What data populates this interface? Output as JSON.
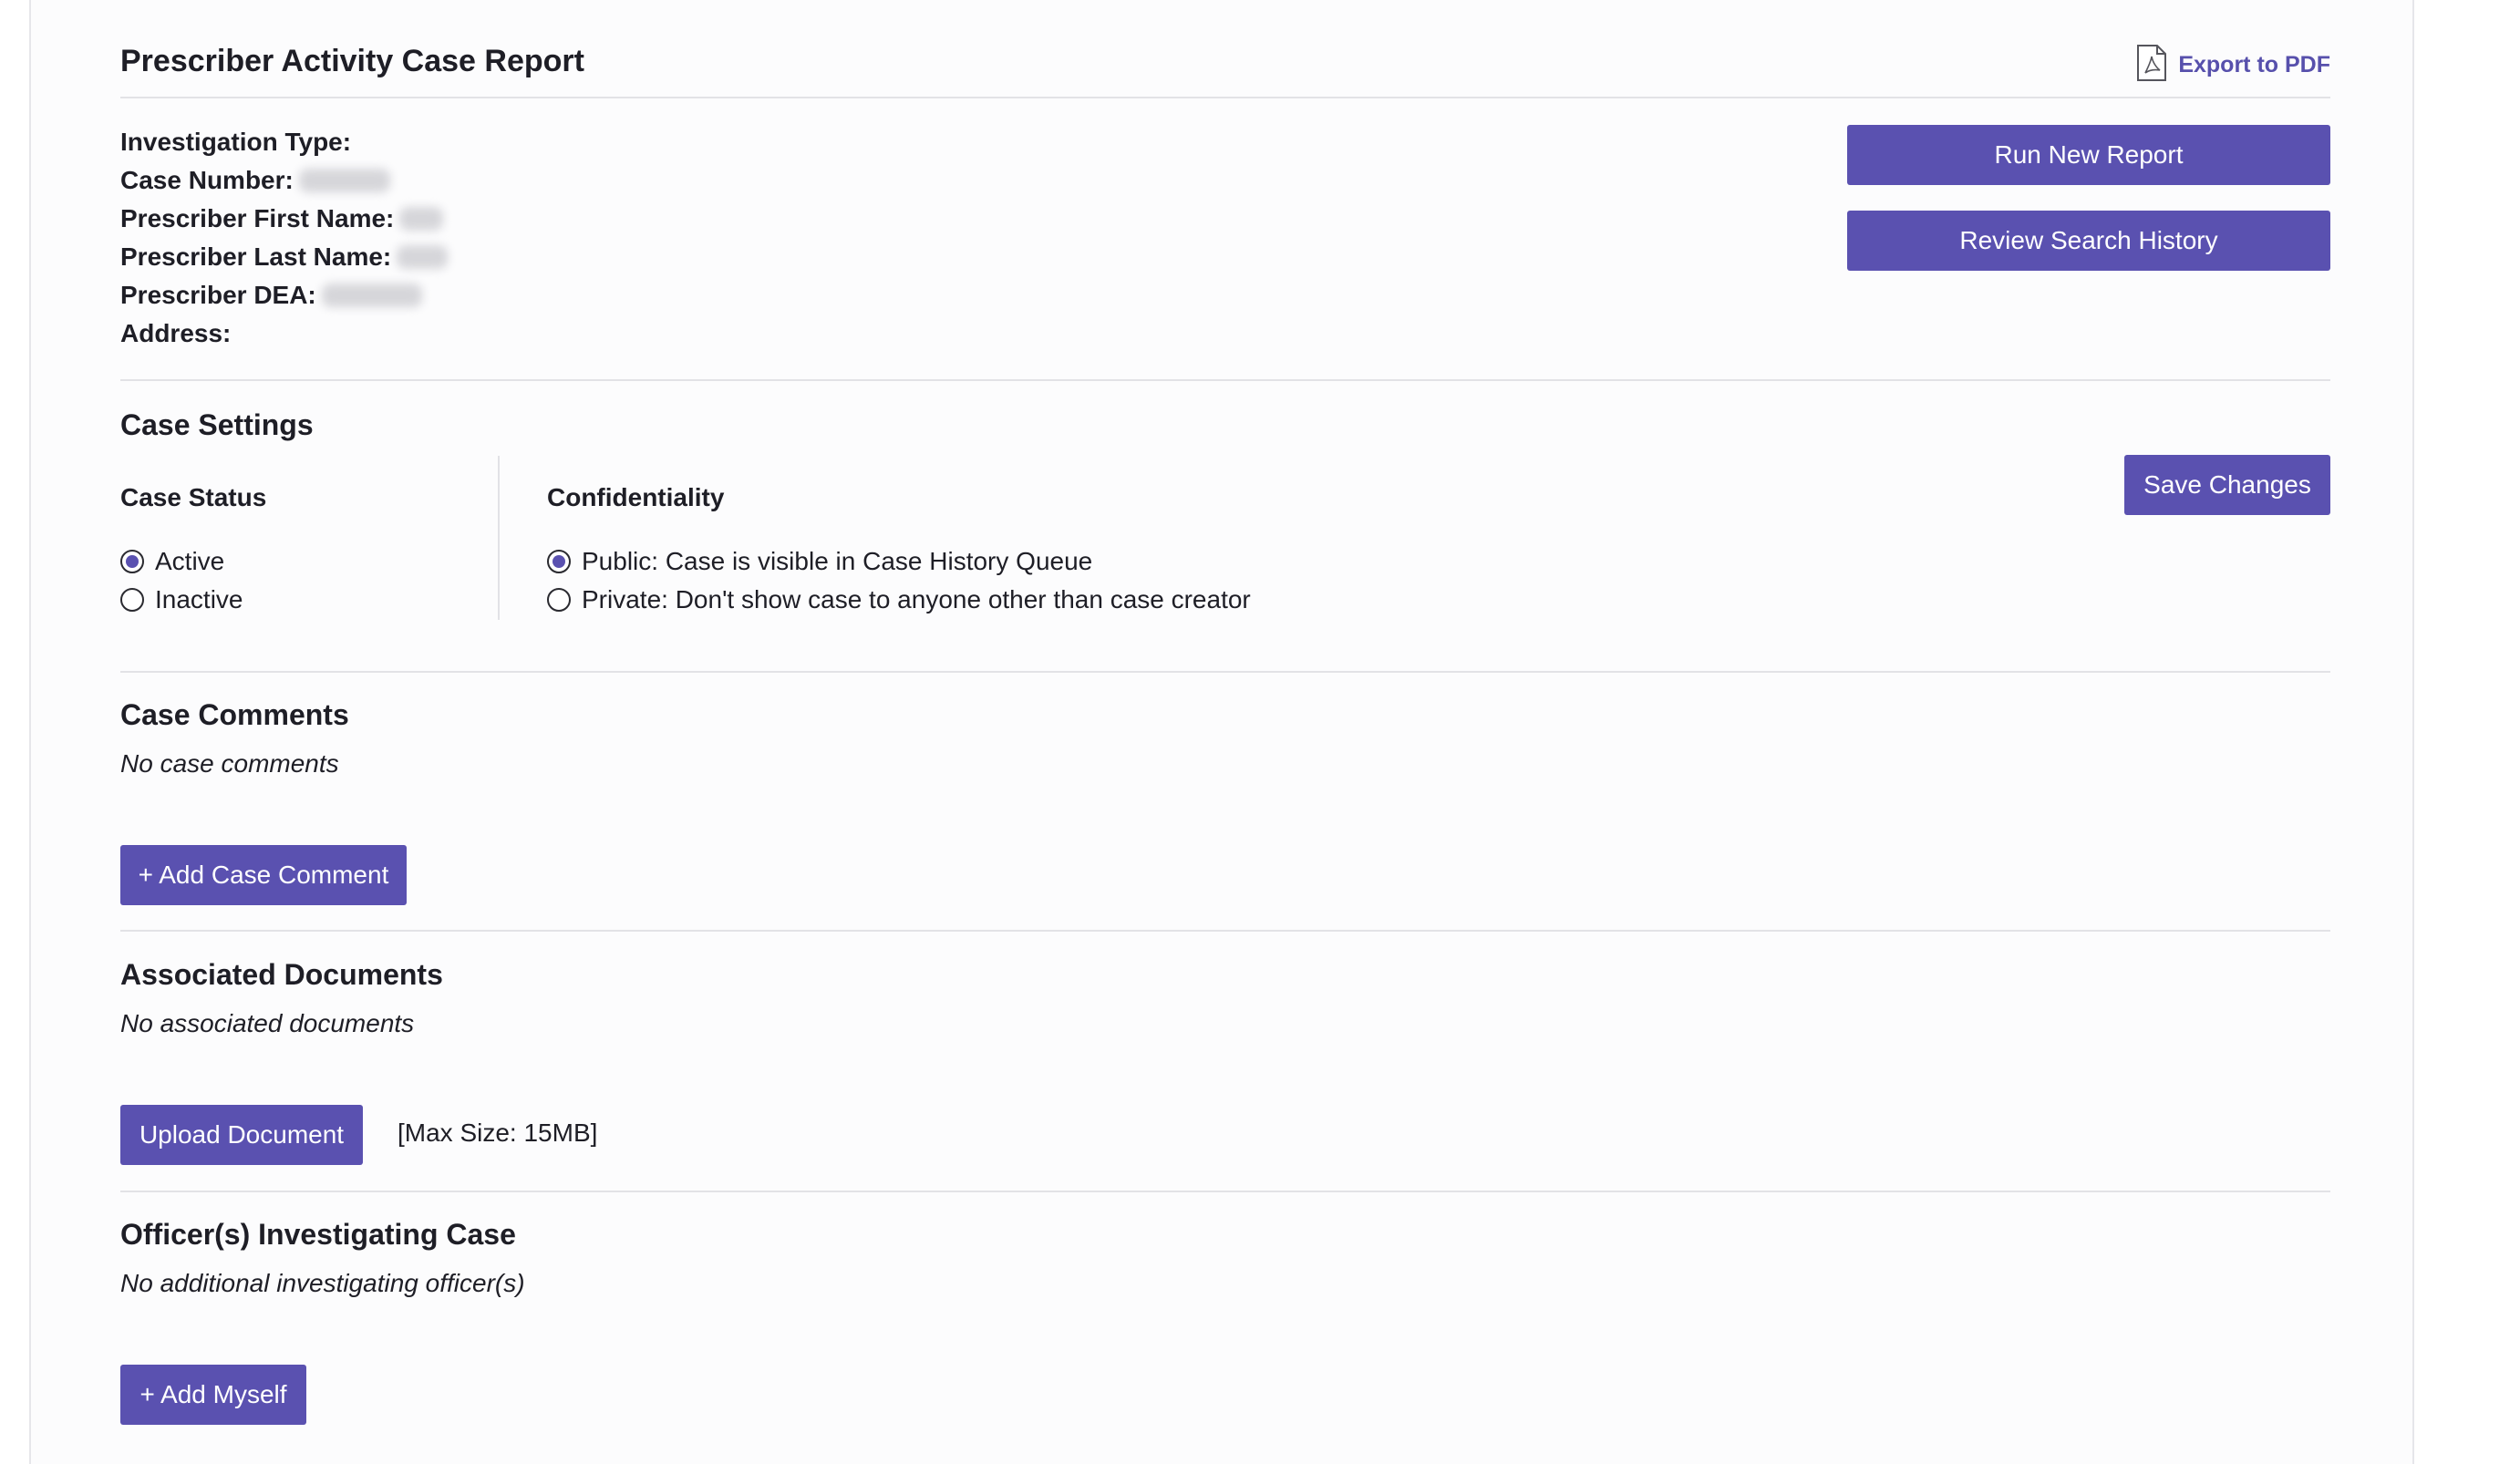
{
  "report": {
    "title": "Prescriber Activity Case Report",
    "export_label": "Export to PDF"
  },
  "details": {
    "investigation_type_label": "Investigation Type:",
    "case_number_label": "Case Number:",
    "first_name_label": "Prescriber First Name:",
    "last_name_label": "Prescriber Last Name:",
    "dea_label": "Prescriber DEA:",
    "address_label": "Address:"
  },
  "actions": {
    "run_new_report": "Run New Report",
    "review_search_history": "Review Search History"
  },
  "case_settings": {
    "title": "Case Settings",
    "save_label": "Save Changes",
    "status": {
      "title": "Case Status",
      "options": [
        {
          "label": "Active",
          "selected": true
        },
        {
          "label": "Inactive",
          "selected": false
        }
      ]
    },
    "confidentiality": {
      "title": "Confidentiality",
      "options": [
        {
          "label": "Public: Case is visible in Case History Queue",
          "selected": true
        },
        {
          "label": "Private: Don't show case to anyone other than case creator",
          "selected": false
        }
      ]
    }
  },
  "comments": {
    "title": "Case Comments",
    "empty": "No case comments",
    "add_label": "+ Add Case Comment"
  },
  "documents": {
    "title": "Associated Documents",
    "empty": "No associated documents",
    "upload_label": "Upload Document",
    "max_size": "[Max Size: 15MB]"
  },
  "officers": {
    "title": "Officer(s) Investigating Case",
    "empty": "No additional investigating officer(s)",
    "add_label": "+ Add Myself"
  },
  "theme": {
    "accent": "#5a51b0",
    "link": "#5750ac"
  }
}
